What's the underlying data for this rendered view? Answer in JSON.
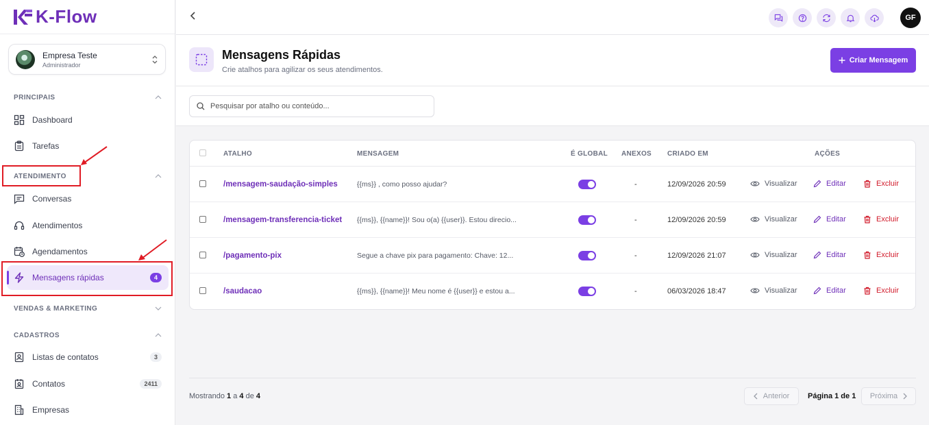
{
  "app": {
    "name": "K-Flow",
    "brand_color": "#6e2fb8",
    "accent_color": "#7b3fe4"
  },
  "company": {
    "name": "Empresa Teste",
    "role": "Administrador"
  },
  "sidebar": {
    "sections": {
      "principais": "PRINCIPAIS",
      "atendimento": "ATENDIMENTO",
      "vendas": "VENDAS & MARKETING",
      "cadastros": "CADASTROS"
    },
    "items": {
      "dashboard": {
        "label": "Dashboard",
        "icon": "dashboard-icon"
      },
      "tarefas": {
        "label": "Tarefas",
        "icon": "clipboard-icon"
      },
      "conversas": {
        "label": "Conversas",
        "icon": "chat-icon"
      },
      "atendimentos": {
        "label": "Atendimentos",
        "icon": "headset-icon"
      },
      "agendamentos": {
        "label": "Agendamentos",
        "icon": "calendar-clock-icon"
      },
      "mensagens": {
        "label": "Mensagens rápidas",
        "icon": "lightning-icon",
        "badge": "4",
        "active": true
      },
      "listas": {
        "label": "Listas de contatos",
        "icon": "contact-book-icon",
        "badge": "3"
      },
      "contatos": {
        "label": "Contatos",
        "icon": "contact-card-icon",
        "badge": "2411"
      },
      "empresas": {
        "label": "Empresas",
        "icon": "building-icon"
      }
    }
  },
  "topbar": {
    "icons": [
      "chat-bubbles-icon",
      "help-icon",
      "refresh-icon",
      "bell-icon",
      "download-cloud-icon"
    ],
    "user_initials": "GF"
  },
  "page": {
    "title": "Mensagens Rápidas",
    "subtitle": "Crie atalhos para agilizar os seus atendimentos.",
    "create_button": "Criar Mensagem"
  },
  "search": {
    "placeholder": "Pesquisar por atalho ou conteúdo..."
  },
  "table": {
    "headers": {
      "atalho": "ATALHO",
      "mensagem": "MENSAGEM",
      "global": "É GLOBAL",
      "anexos": "ANEXOS",
      "criado": "CRIADO EM",
      "acoes": "AÇÕES"
    },
    "actions": {
      "view": "Visualizar",
      "edit": "Editar",
      "delete": "Excluir"
    },
    "rows": [
      {
        "shortcut": "/mensagem-saudação-simples",
        "message": "{{ms}} , como posso ajudar?",
        "global": true,
        "attachments": "-",
        "created": "12/09/2026 20:59"
      },
      {
        "shortcut": "/mensagem-transferencia-ticket",
        "message": "{{ms}}, {{name}}! Sou o(a) {{user}}. Estou direcio...",
        "global": true,
        "attachments": "-",
        "created": "12/09/2026 20:59"
      },
      {
        "shortcut": "/pagamento-pix",
        "message": "Segue a chave pix para pagamento: Chave: 12...",
        "global": true,
        "attachments": "-",
        "created": "12/09/2026 21:07"
      },
      {
        "shortcut": "/saudacao",
        "message": "{{ms}}, {{name}}! Meu nome é {{user}} e estou a...",
        "global": true,
        "attachments": "-",
        "created": "06/03/2026 18:47"
      }
    ]
  },
  "pagination": {
    "showing_prefix": "Mostrando",
    "from": "1",
    "sep_a": "a",
    "to": "4",
    "sep_de": "de",
    "total": "4",
    "prev": "Anterior",
    "page_info": "Página 1 de 1",
    "next": "Próxima"
  }
}
